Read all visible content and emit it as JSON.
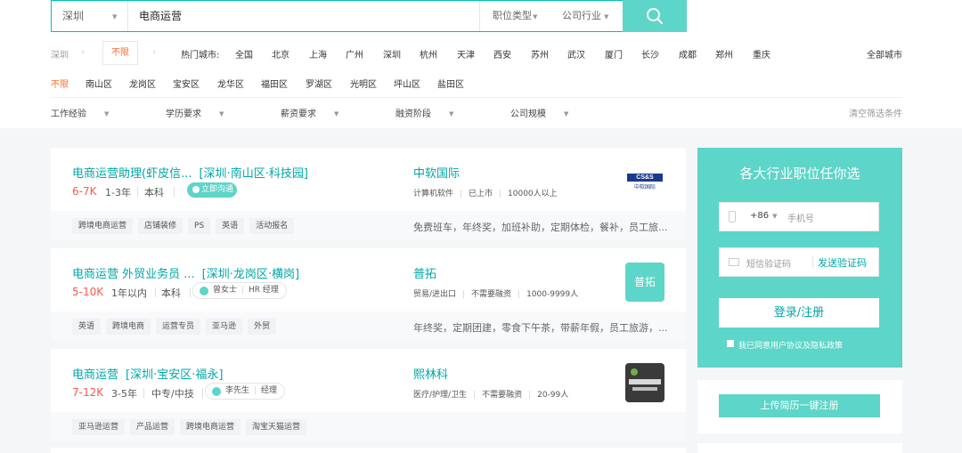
{
  "search": {
    "city": "深圳",
    "query": "电商运营",
    "job_type": "职位类型",
    "industry": "公司行业",
    "button_icon": "search-icon"
  },
  "city_row": {
    "crumb": "深圳",
    "unlimited": "不限",
    "hot_label": "热门城市:",
    "cities": [
      "全国",
      "北京",
      "上海",
      "广州",
      "深圳",
      "杭州",
      "天津",
      "西安",
      "苏州",
      "武汉",
      "厦门",
      "长沙",
      "成都",
      "郑州",
      "重庆"
    ],
    "all_cities": "全部城市"
  },
  "district_row": {
    "items": [
      "不限",
      "南山区",
      "龙岗区",
      "宝安区",
      "龙华区",
      "福田区",
      "罗湖区",
      "光明区",
      "坪山区",
      "盐田区"
    ]
  },
  "filters": {
    "items": [
      "工作经验",
      "学历要求",
      "薪资要求",
      "融资阶段",
      "公司规模"
    ],
    "clear": "清空筛选条件"
  },
  "jobs": [
    {
      "title": "电商运营助理(虾皮信...",
      "address": "[深圳·南山区·科技园]",
      "salary": "6-7K",
      "experience": "1-3年",
      "education": "本科",
      "chat": "立即沟通",
      "company": "中软国际",
      "company_info": [
        "计算机软件",
        "已上市",
        "10000人以上"
      ],
      "logo_text": "CS&S",
      "logo_sub": "中软国际",
      "tags": [
        "跨境电商运营",
        "店铺装修",
        "PS",
        "英语",
        "活动报名"
      ],
      "welfare": "免费班车，年终奖，加班补助，定期体检，餐补，员工旅..."
    },
    {
      "title": "电商运营 外贸业务员 ...",
      "address": "[深圳·龙岗区·横岗]",
      "salary": "5-10K",
      "experience": "1年以内",
      "education": "本科",
      "hr_name": "曾女士",
      "hr_role": "HR 经理",
      "company": "普拓",
      "company_info": [
        "贸易/进出口",
        "不需要融资",
        "1000-9999人"
      ],
      "logo_text": "普拓",
      "tags": [
        "英语",
        "跨境电商",
        "运营专员",
        "亚马逊",
        "外贸"
      ],
      "welfare": "年终奖，定期团建，零食下午茶，带薪年假，员工旅游，..."
    },
    {
      "title": "电商运营",
      "address": "[深圳·宝安区·福永]",
      "salary": "7-12K",
      "experience": "3-5年",
      "education": "中专/中技",
      "hr_name": "李先生",
      "hr_role": "经理",
      "company": "熙林科",
      "company_info": [
        "医疗/护理/卫生",
        "不需要融资",
        "20-99人"
      ],
      "tags": [
        "亚马逊运营",
        "产品运营",
        "跨境电商运营",
        "淘宝天猫运营"
      ]
    }
  ],
  "sidebar": {
    "title": "各大行业职位任你选",
    "country_code": "+86",
    "phone_placeholder": "手机号",
    "code_placeholder": "短信验证码",
    "send_code": "发送验证码",
    "login": "登录/注册",
    "agree": "我已同意用户协议及隐私政策",
    "upload": "上传简历一键注册"
  },
  "colors": {
    "accent": "#5dd5c8",
    "link": "#00a6a7",
    "salary": "#fe574a",
    "active": "#ff6a2b"
  }
}
